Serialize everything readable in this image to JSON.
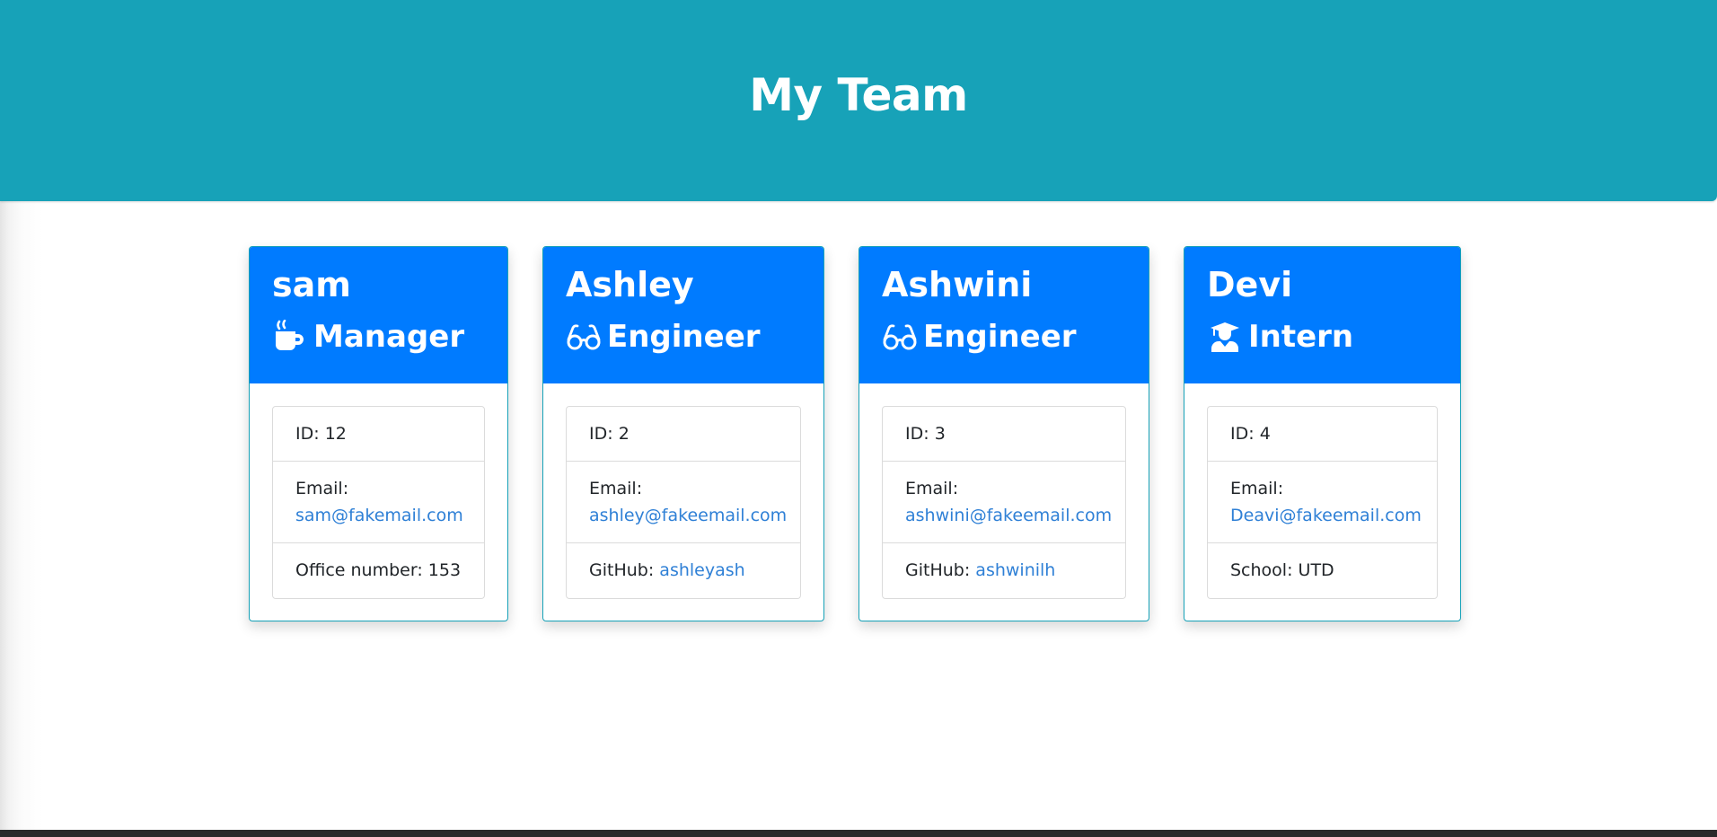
{
  "header": {
    "title": "My Team",
    "background": "#17a2b8"
  },
  "colors": {
    "card_header": "#007bff",
    "link": "#2f80d6"
  },
  "employees": [
    {
      "name": "sam",
      "role": "Manager",
      "role_icon": "mug-hot-icon",
      "id_label": "ID:",
      "id": "12",
      "email_label": "Email:",
      "email": "sam@fakemail.com",
      "extra_label": "Office number:",
      "extra_value": "153"
    },
    {
      "name": "Ashley",
      "role": "Engineer",
      "role_icon": "glasses-icon",
      "id_label": "ID:",
      "id": "2",
      "email_label": "Email:",
      "email": "ashley@fakeemail.com",
      "extra_label": "GitHub:",
      "extra_value": "ashleyash"
    },
    {
      "name": "Ashwini",
      "role": "Engineer",
      "role_icon": "glasses-icon",
      "id_label": "ID:",
      "id": "3",
      "email_label": "Email:",
      "email": "ashwini@fakeemail.com",
      "extra_label": "GitHub:",
      "extra_value": "ashwinilh"
    },
    {
      "name": "Devi",
      "role": "Intern",
      "role_icon": "user-graduate-icon",
      "id_label": "ID:",
      "id": "4",
      "email_label": "Email:",
      "email": "Deavi@fakeemail.com",
      "extra_label": "School:",
      "extra_value": "UTD"
    }
  ]
}
